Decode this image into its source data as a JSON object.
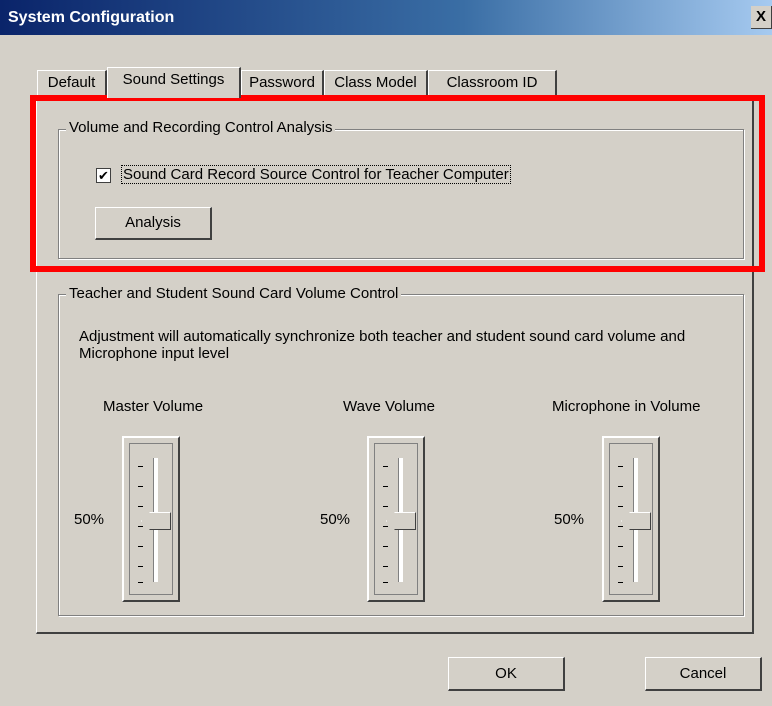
{
  "window": {
    "title": "System Configuration",
    "close_glyph": "X"
  },
  "tabs": [
    {
      "label": "Default",
      "active": false
    },
    {
      "label": "Sound Settings",
      "active": true
    },
    {
      "label": "Password",
      "active": false
    },
    {
      "label": "Class Model",
      "active": false
    },
    {
      "label": "Classroom ID",
      "active": false
    }
  ],
  "recording_group": {
    "title": "Volume and Recording Control Analysis",
    "checkbox_label": "Sound Card Record Source Control for Teacher Computer",
    "checkbox_checked": true,
    "checkbox_glyph": "✔",
    "analysis_button": "Analysis"
  },
  "volume_group": {
    "title": "Teacher and Student Sound Card Volume Control",
    "description_line1": "Adjustment will automatically synchronize both teacher and student sound card volume and",
    "description_line2": "Microphone input level",
    "sliders": [
      {
        "label": "Master Volume",
        "value_text": "50%",
        "value": 0.5
      },
      {
        "label": "Wave Volume",
        "value_text": "50%",
        "value": 0.5
      },
      {
        "label": "Microphone in Volume",
        "value_text": "50%",
        "value": 0.5
      }
    ]
  },
  "buttons": {
    "ok": "OK",
    "cancel": "Cancel"
  },
  "colors": {
    "highlight": "#ff0000",
    "face": "#d4d0c8",
    "titlebar": "#0a246a"
  }
}
